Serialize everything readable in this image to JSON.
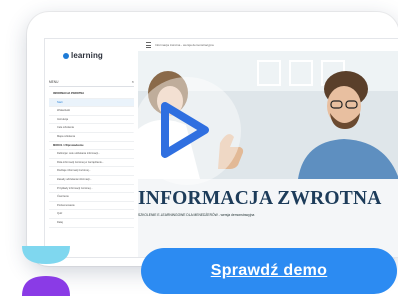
{
  "app": {
    "logo_text": "learning",
    "breadcrumb": "Informacja zwrotna - wersja demonstracyjna"
  },
  "sidebar": {
    "menu_label": "MENU",
    "items": [
      {
        "label": "INFORMACJA ZWROTNA",
        "type": "section"
      },
      {
        "label": "Start",
        "type": "item"
      },
      {
        "label": "Wskazówki",
        "type": "item"
      },
      {
        "label": "Instrukcja",
        "type": "item"
      },
      {
        "label": "Cele szkolenia",
        "type": "item"
      },
      {
        "label": "Mapa szkolenia",
        "type": "item"
      },
      {
        "label": "MODUŁ 1 Wprowadzenie",
        "type": "section"
      },
      {
        "label": "Definicja i cele udzielania informacji...",
        "type": "item"
      },
      {
        "label": "Rola informacji zwrotnej w zarządzaniu...",
        "type": "item"
      },
      {
        "label": "Rodzaje informacji zwrotnej...",
        "type": "item"
      },
      {
        "label": "Zasady udzielania informacji...",
        "type": "item"
      },
      {
        "label": "Przykłady informacji zwrotnej...",
        "type": "item"
      },
      {
        "label": "Ćwiczenie",
        "type": "item"
      },
      {
        "label": "Podsumowanie",
        "type": "item"
      },
      {
        "label": "Quiz",
        "type": "item"
      },
      {
        "label": "Dalej",
        "type": "item"
      }
    ]
  },
  "content": {
    "title": "INFORMACJA ZWROTNA",
    "subtitle": "SZKOLENIE E-LEARNINGOWE DLA MENEDŻERÓW - wersja demonstracyjna",
    "play_icon": "play-icon"
  },
  "cta": {
    "label": "Sprawdź demo"
  },
  "colors": {
    "cta_blue": "#2c8bf2",
    "play_blue": "#2f6fe0",
    "title_navy": "#1d3c5a",
    "deco_top": "#7fd7ef",
    "deco_bottom": "#8a3be6"
  }
}
